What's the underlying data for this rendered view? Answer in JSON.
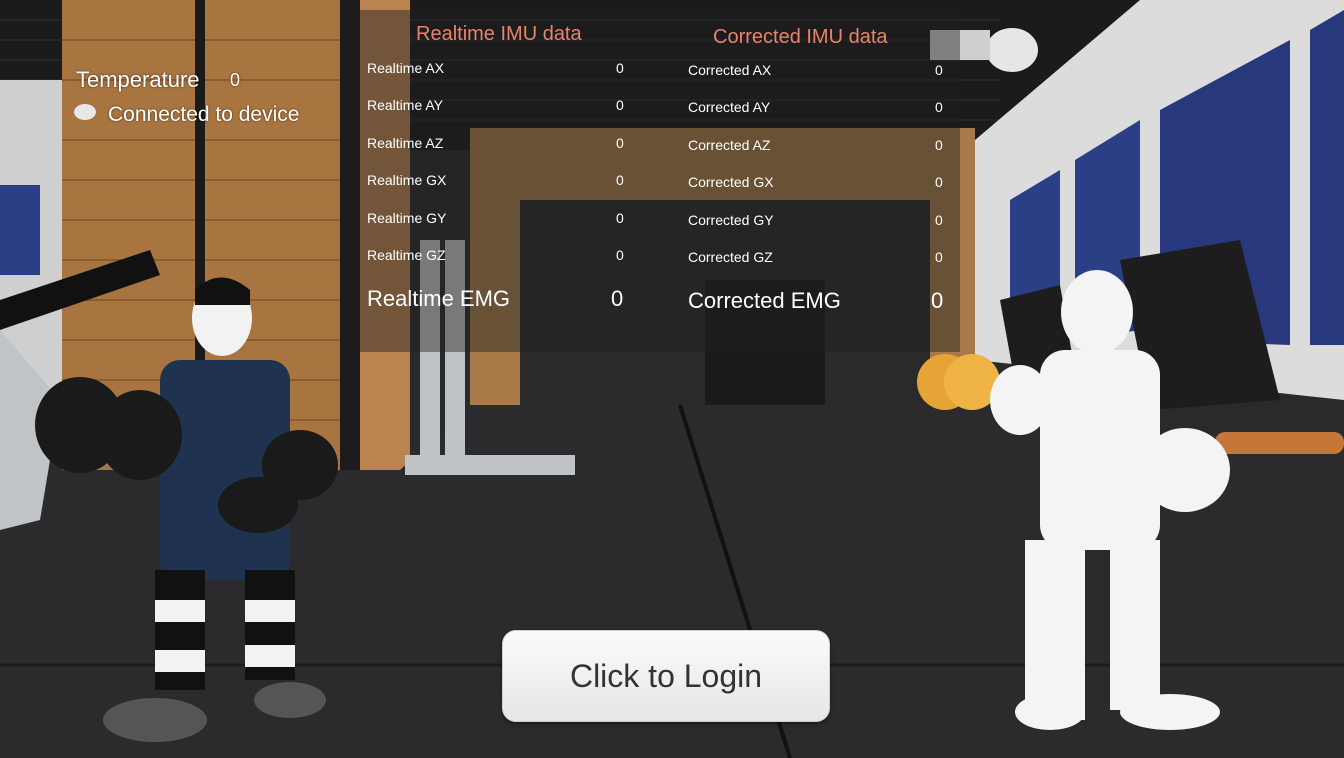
{
  "status": {
    "temperature_label": "Temperature",
    "temperature_value": "0",
    "connection_label": "Connected to device"
  },
  "realtime": {
    "header": "Realtime IMU data",
    "rows": [
      {
        "label": "Realtime AX",
        "value": "0"
      },
      {
        "label": "Realtime AY",
        "value": "0"
      },
      {
        "label": "Realtime AZ",
        "value": "0"
      },
      {
        "label": "Realtime GX",
        "value": "0"
      },
      {
        "label": "Realtime GY",
        "value": "0"
      },
      {
        "label": "Realtime GZ",
        "value": "0"
      }
    ],
    "emg_label": "Realtime EMG",
    "emg_value": "0"
  },
  "corrected": {
    "header": "Corrected IMU data",
    "rows": [
      {
        "label": "Corrected AX",
        "value": "0"
      },
      {
        "label": "Corrected AY",
        "value": "0"
      },
      {
        "label": "Corrected AZ",
        "value": "0"
      },
      {
        "label": "Corrected GX",
        "value": "0"
      },
      {
        "label": "Corrected GY",
        "value": "0"
      },
      {
        "label": "Corrected GZ",
        "value": "0"
      }
    ],
    "emg_label": "Corrected EMG",
    "emg_value": "0"
  },
  "login": {
    "label": "Click to Login"
  },
  "colors": {
    "header_accent": "#e8836b",
    "floor": "#2b2b2d",
    "wood": "#b07d49",
    "window_sky": "#243a7a"
  }
}
